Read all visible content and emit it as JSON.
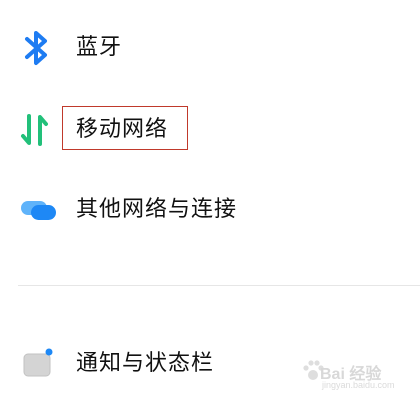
{
  "settings": {
    "items": [
      {
        "label": "蓝牙",
        "icon": "bluetooth-icon",
        "icon_color": "#1e7cf2"
      },
      {
        "label": "移动网络",
        "icon": "mobile-data-arrows-icon",
        "icon_color": "#22c07a"
      },
      {
        "label": "其他网络与连接",
        "icon": "connections-icon",
        "icon_color": "#1e88f5"
      },
      {
        "label": "通知与状态栏",
        "icon": "notification-icon",
        "icon_color": "#c7c7c7"
      }
    ],
    "highlight_color": "#c0392b"
  },
  "watermark": {
    "text": "Bai 经验",
    "sub": "jingyan.baidu.com"
  }
}
